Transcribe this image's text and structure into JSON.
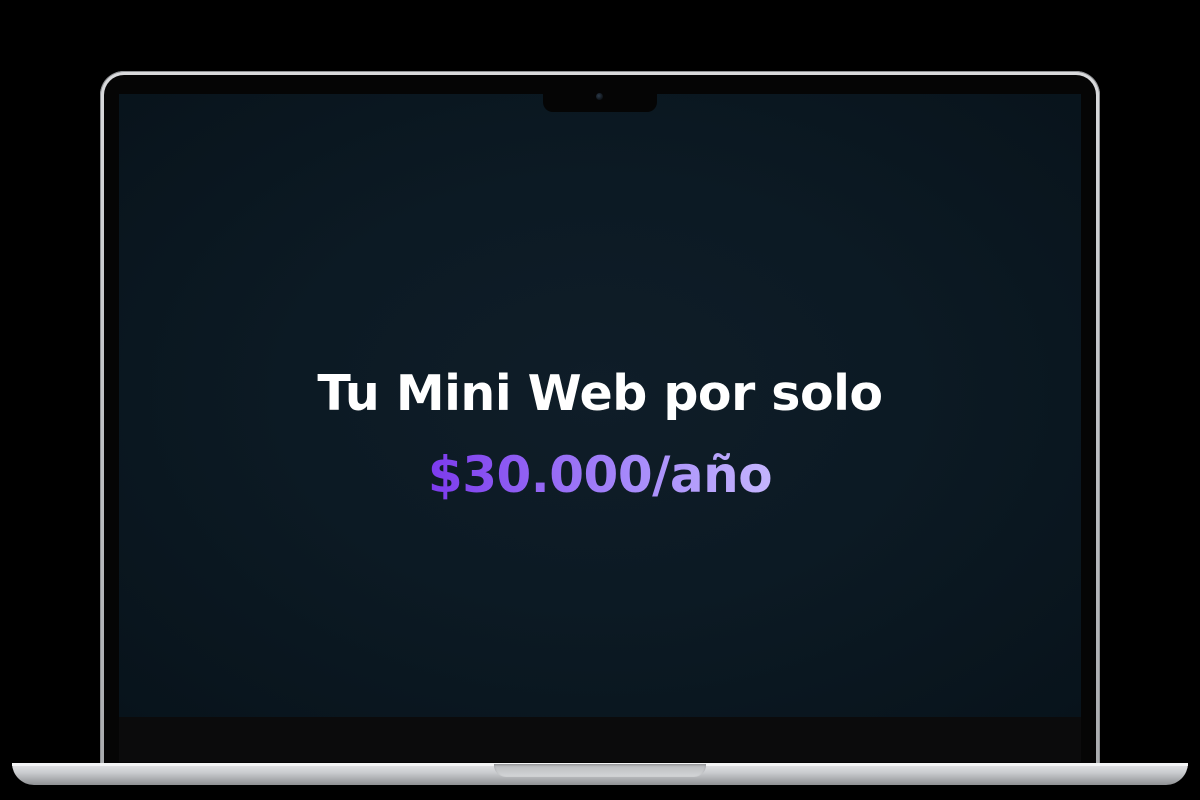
{
  "hero": {
    "headline": "Tu Mini Web por solo",
    "price": "$30.000/año"
  },
  "colors": {
    "background": "#000000",
    "screen": "#0c1a24",
    "headline_text": "#ffffff",
    "price_gradient_start": "#7c3aed",
    "price_gradient_end": "#c4b5fd",
    "laptop_body": "#c9cbce"
  }
}
